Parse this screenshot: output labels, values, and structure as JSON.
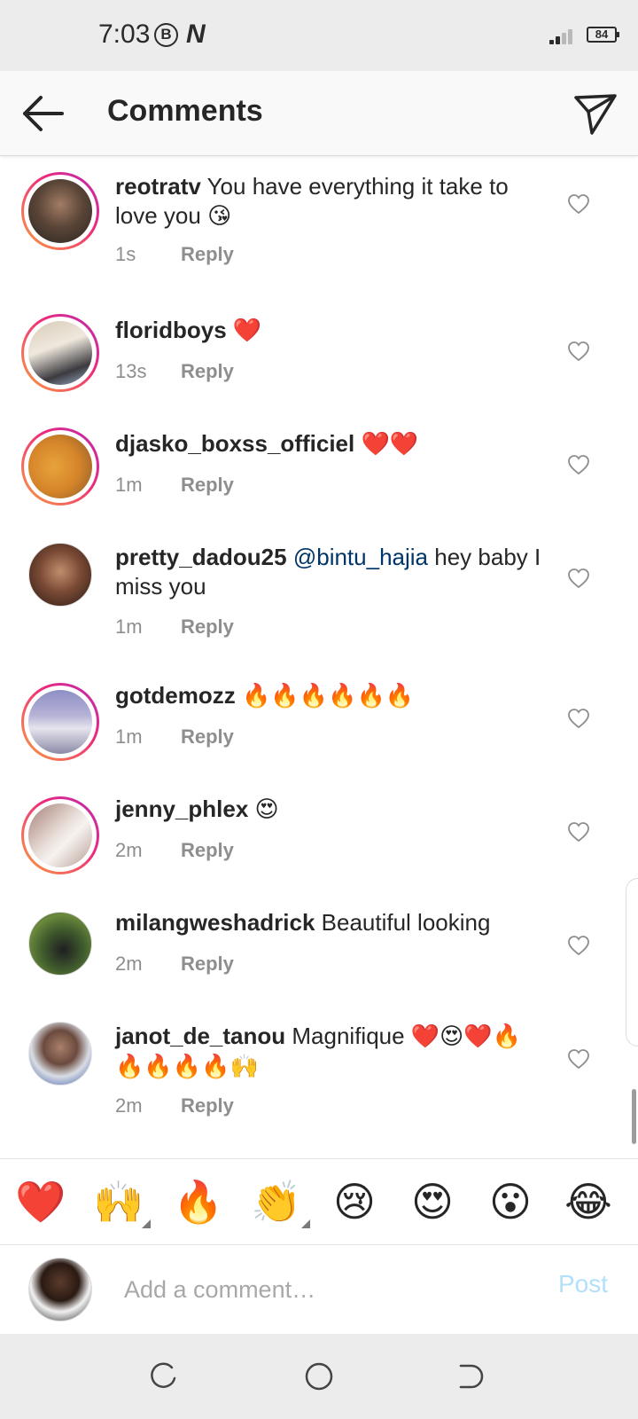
{
  "status_bar": {
    "time": "7:03",
    "b_icon": "B",
    "battery": "84"
  },
  "header": {
    "title": "Comments"
  },
  "comments": [
    {
      "username": "reotratv",
      "mention": "",
      "text": "You have everything it take to love you",
      "emoji": "😘",
      "time": "1s",
      "reply_label": "Reply"
    },
    {
      "username": "floridboys",
      "mention": "",
      "text": "",
      "emoji": "❤️",
      "time": "13s",
      "reply_label": "Reply"
    },
    {
      "username": "djasko_boxss_officiel",
      "mention": "",
      "text": "",
      "emoji": "❤️❤️",
      "time": "1m",
      "reply_label": "Reply"
    },
    {
      "username": "pretty_dadou25",
      "mention": "@bintu_hajia",
      "text": "hey baby I miss you",
      "emoji": "",
      "time": "1m",
      "reply_label": "Reply"
    },
    {
      "username": "gotdemozz",
      "mention": "",
      "text": "",
      "emoji": "🔥🔥🔥🔥🔥🔥",
      "time": "1m",
      "reply_label": "Reply"
    },
    {
      "username": "jenny_phlex",
      "mention": "",
      "text": "",
      "emoji": "😍",
      "time": "2m",
      "reply_label": "Reply"
    },
    {
      "username": "milangweshadrick",
      "mention": "",
      "text": "Beautiful looking",
      "emoji": "",
      "time": "2m",
      "reply_label": "Reply"
    },
    {
      "username": "janot_de_tanou",
      "mention": "",
      "text": "Magnifique",
      "emoji": "❤️😍❤️🔥🔥🔥🔥🔥🙌",
      "time": "2m",
      "reply_label": "Reply"
    }
  ],
  "quick_emojis": [
    "❤️",
    "🙌",
    "🔥",
    "👏",
    "😢",
    "😍",
    "😮",
    "😂"
  ],
  "input": {
    "placeholder": "Add a comment…",
    "post_label": "Post"
  },
  "colors": {
    "accent": "#0095f6",
    "post_disabled": "#b2dffc",
    "mention": "#003569",
    "muted": "#8e8e8e"
  }
}
